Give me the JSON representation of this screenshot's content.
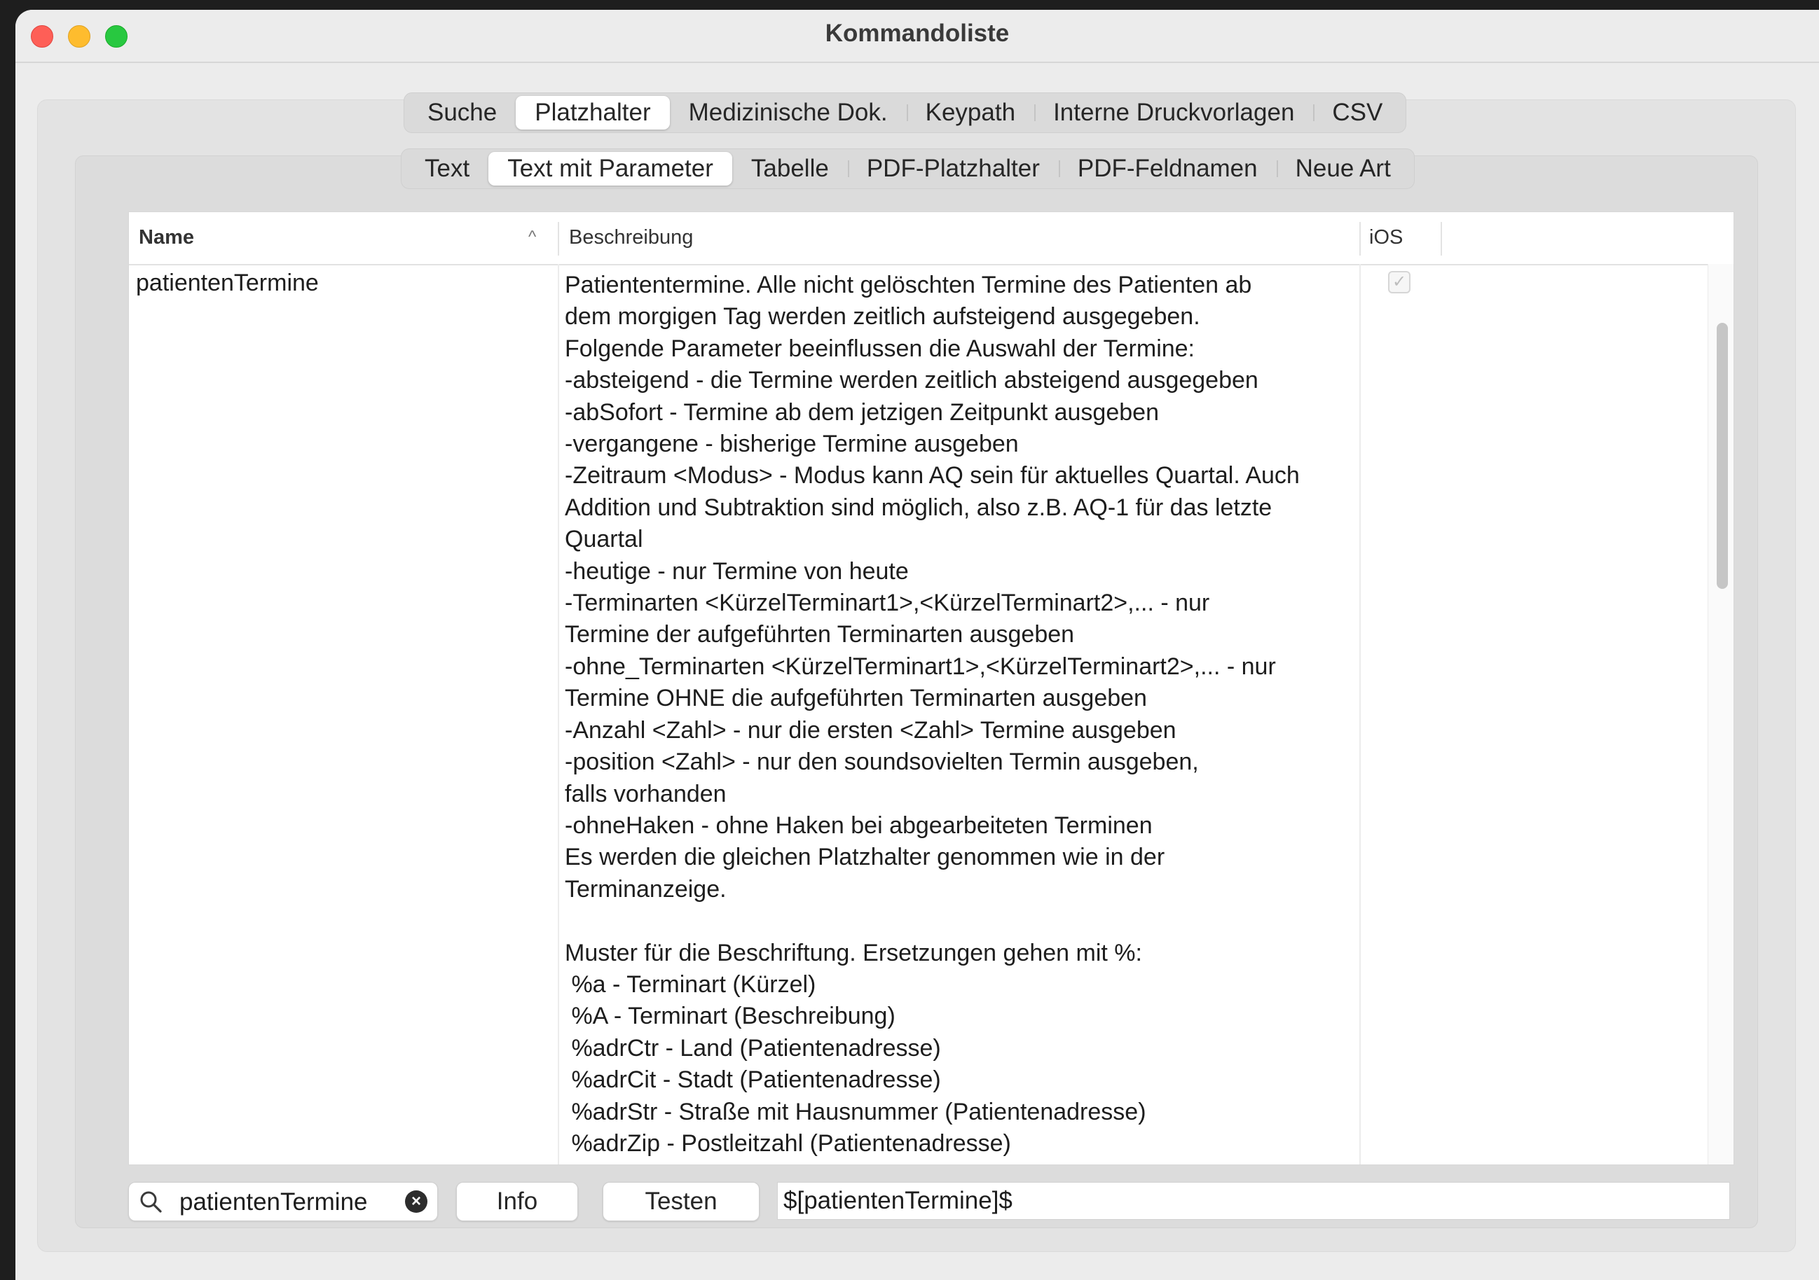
{
  "window": {
    "title": "Kommandoliste"
  },
  "tabs_main": [
    "Suche",
    "Platzhalter",
    "Medizinische Dok.",
    "Keypath",
    "Interne Druckvorlagen",
    "CSV"
  ],
  "tabs_main_active": "Platzhalter",
  "tabs_sub": [
    "Text",
    "Text mit Parameter",
    "Tabelle",
    "PDF-Platzhalter",
    "PDF-Feldnamen",
    "Neue Art"
  ],
  "tabs_sub_active": "Text mit Parameter",
  "table": {
    "columns": {
      "name": "Name",
      "description": "Beschreibung",
      "ios": "iOS"
    },
    "sort": "ascending",
    "rows": [
      {
        "name": "patientenTermine",
        "description": "Patiententermine. Alle nicht gelöschten Termine des Patienten ab\ndem morgigen Tag werden zeitlich aufsteigend ausgegeben.\nFolgende Parameter beeinflussen die Auswahl der Termine:\n-absteigend - die Termine werden zeitlich absteigend ausgegeben\n-abSofort - Termine ab dem jetzigen Zeitpunkt ausgeben\n-vergangene - bisherige Termine ausgeben\n-Zeitraum <Modus> - Modus kann AQ sein für aktuelles Quartal. Auch\nAddition und Subtraktion sind möglich, also z.B. AQ-1 für das letzte\nQuartal\n-heutige - nur Termine von heute\n-Terminarten <KürzelTerminart1>,<KürzelTerminart2>,... - nur\nTermine der aufgeführten Terminarten ausgeben\n-ohne_Terminarten <KürzelTerminart1>,<KürzelTerminart2>,... - nur\nTermine OHNE die aufgeführten Terminarten ausgeben\n-Anzahl <Zahl> - nur die ersten <Zahl> Termine ausgeben\n-position <Zahl> - nur den soundsovielten Termin ausgeben,\nfalls vorhanden\n-ohneHaken - ohne Haken bei abgearbeiteten Terminen\nEs werden die gleichen Platzhalter genommen wie in der\nTerminanzeige.\n\nMuster für die Beschriftung. Ersetzungen gehen mit %:\n %a - Terminart (Kürzel)\n %A - Terminart (Beschreibung)\n %adrCtr - Land (Patientenadresse)\n %adrCit - Stadt (Patientenadresse)\n %adrStr - Straße mit Hausnummer (Patientenadresse)\n %adrZip - Postleitzahl (Patientenadresse)",
        "ios_checked": true
      }
    ]
  },
  "bottom": {
    "search_value": "patientenTermine",
    "info_label": "Info",
    "test_label": "Testen",
    "output_value": "$[patientenTermine]$"
  }
}
